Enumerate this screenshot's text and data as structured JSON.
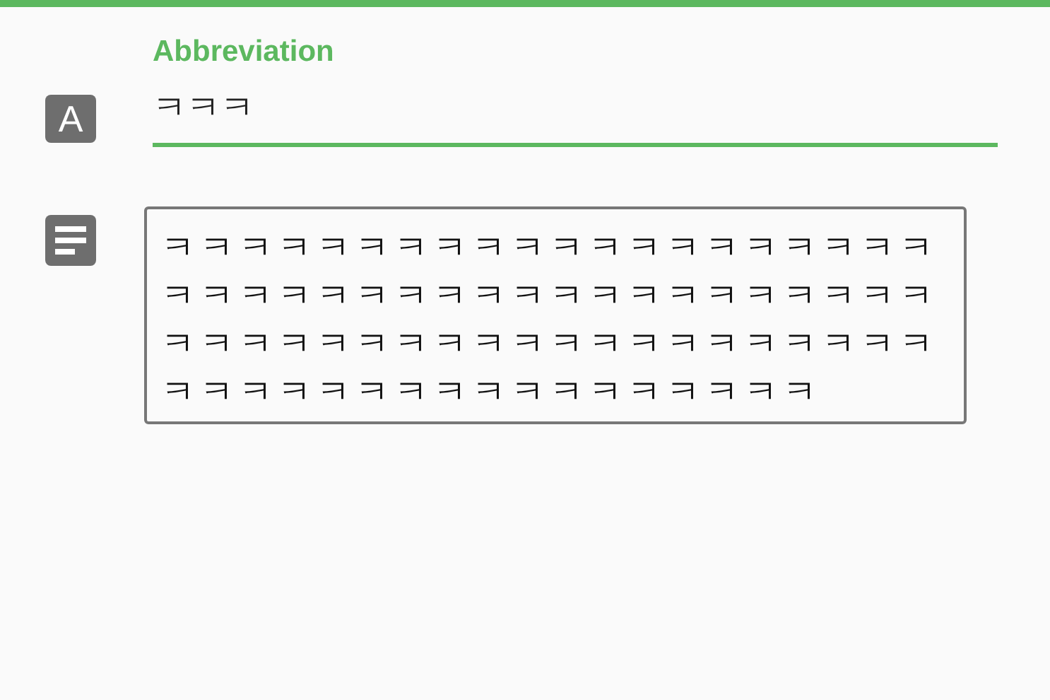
{
  "abbreviation": {
    "label": "Abbreviation",
    "icon_letter": "A",
    "value": "ㅋㅋㅋ",
    "focused": true
  },
  "description": {
    "value": "ㅋㅋㅋㅋㅋㅋㅋㅋㅋㅋㅋㅋㅋㅋㅋㅋㅋㅋㅋㅋㅋㅋㅋㅋㅋㅋㅋㅋㅋㅋㅋㅋㅋㅋㅋㅋㅋㅋㅋㅋㅋㅋㅋㅋㅋㅋㅋㅋㅋㅋㅋㅋㅋㅋㅋㅋㅋㅋㅋㅋㅋㅋㅋㅋㅋㅋㅋㅋㅋㅋㅋㅋㅋㅋㅋㅋㅋ"
  }
}
